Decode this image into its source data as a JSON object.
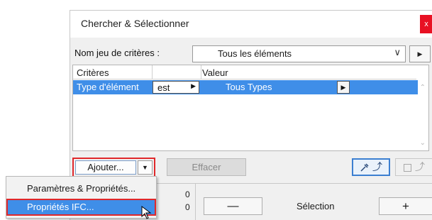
{
  "dialog": {
    "title": "Chercher & Sélectionner",
    "close_label": "x",
    "criteria_set_label": "Nom jeu de critères :",
    "criteria_set_value": "Tous les éléments",
    "dropdown_glyph": "∨",
    "next_glyph": "▶"
  },
  "criteria_table": {
    "headers": [
      "Critères",
      "Valeur"
    ],
    "rows": [
      {
        "criterion": "Type d'élément",
        "operator": "est",
        "operator_glyph": "▶",
        "value": "Tous Types",
        "value_glyph": "▶"
      }
    ],
    "scroll_up_glyph": "⌃",
    "scroll_down_glyph": "⌄"
  },
  "toolbar": {
    "add_label": "Ajouter...",
    "add_dropdown_glyph": "▼",
    "clear_label": "Effacer",
    "pick_glyph": "⤴",
    "frame_glyph": "⤴"
  },
  "selection_panel": {
    "count_top": "0",
    "count_bottom": "0",
    "minus_label": "—",
    "selection_label": "Sélection",
    "plus_label": "+"
  },
  "add_menu": {
    "items": [
      "Paramètres & Propriétés...",
      "Propriétés IFC..."
    ],
    "highlighted_index": 1
  },
  "colors": {
    "selection_blue": "#3f8ee8",
    "highlight_red": "#e0282b",
    "close_red": "#e81123"
  }
}
